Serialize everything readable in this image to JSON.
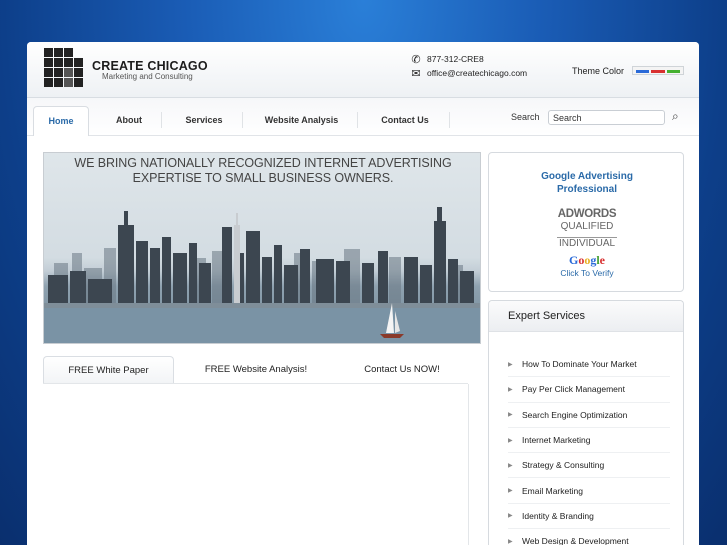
{
  "header": {
    "logo_title": "CREATE CHICAGO",
    "logo_subtitle": "Marketing and Consulting",
    "phone": "877-312-CRE8",
    "email": "office@createchicago.com",
    "theme_label": "Theme Color",
    "theme_colors": [
      "#2a6ad8",
      "#d83030",
      "#44b030"
    ]
  },
  "nav": {
    "tabs": [
      {
        "label": "Home",
        "active": true
      },
      {
        "label": "About"
      },
      {
        "label": "Services"
      },
      {
        "label": "Website Analysis"
      },
      {
        "label": "Contact Us"
      }
    ],
    "search_label": "Search",
    "search_placeholder": "Search"
  },
  "hero": {
    "line1": "WE BRING NATIONALLY RECOGNIZED INTERNET ADVERTISING",
    "line2": "EXPERTISE TO SMALL BUSINESS OWNERS."
  },
  "content_tabs": [
    {
      "label": "FREE White Paper",
      "active": true
    },
    {
      "label": "FREE Website Analysis!"
    },
    {
      "label": "Contact Us NOW!"
    }
  ],
  "google_box": {
    "title_line1": "Google Advertising",
    "title_line2": "Professional",
    "badge_line1": "ADWORDS",
    "badge_line2": "QUALIFIED",
    "badge_line3": "INDIVIDUAL",
    "badge_google": "Google",
    "verify": "Click To Verify"
  },
  "expert_services": {
    "title": "Expert Services",
    "items": [
      "How To Dominate Your Market",
      "Pay Per Click Management",
      "Search Engine Optimization",
      "Internet Marketing",
      "Strategy & Consulting",
      "Email Marketing",
      "Identity & Branding",
      "Web Design & Development"
    ]
  }
}
